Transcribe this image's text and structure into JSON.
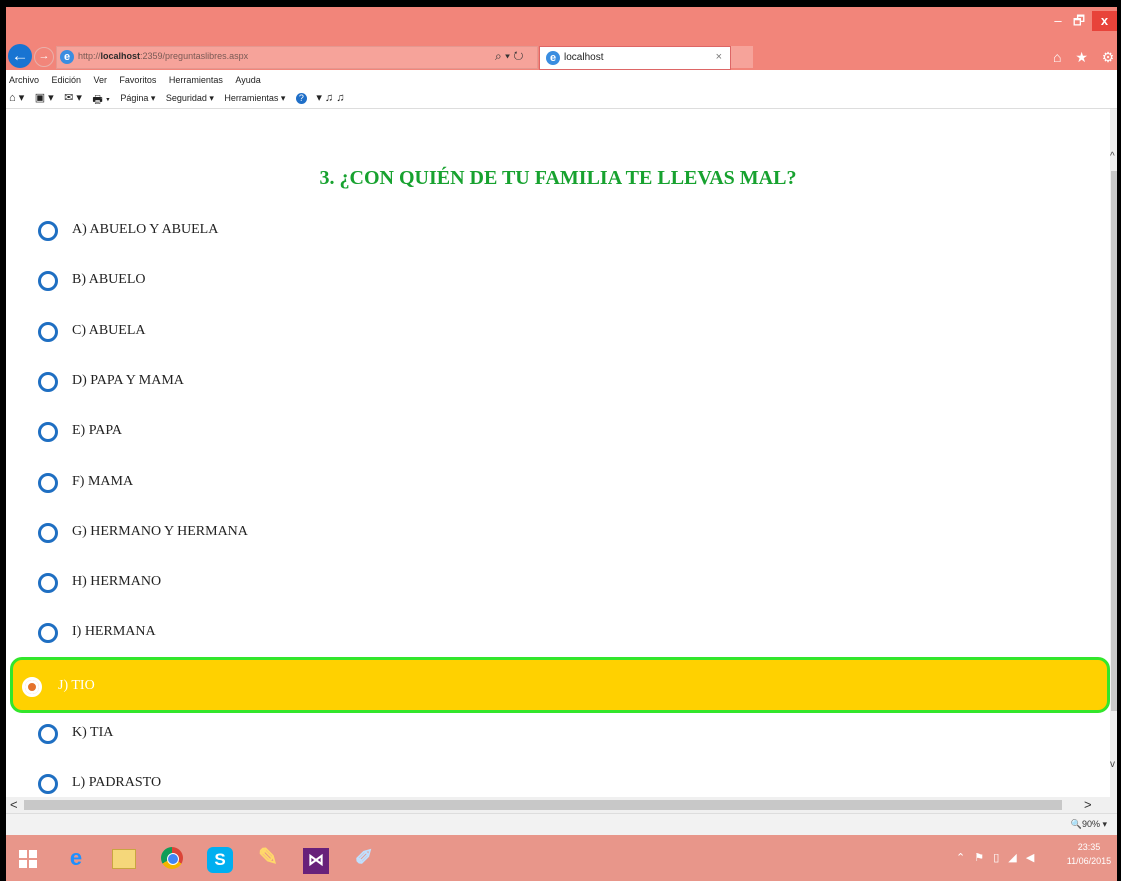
{
  "window": {
    "controls": {
      "minimize": "–",
      "maximize": "🗗",
      "close": "x"
    }
  },
  "navigation": {
    "back_glyph": "←",
    "forward_glyph": "→",
    "address_prefix": "http://",
    "address_host": "localhost",
    "address_path": ":2359/preguntaslibres.aspx",
    "search_controls": "⌕ ▾ ↻",
    "tab_label": "localhost",
    "tab_close": "×",
    "toolbar_icons": "⌂ ★ ⚙"
  },
  "menu": {
    "items": [
      "Archivo",
      "Edición",
      "Ver",
      "Favoritos",
      "Herramientas",
      "Ayuda"
    ]
  },
  "command_bar": {
    "home_glyph": "⌂ ▾",
    "feeds_glyph": "▣ ▾",
    "mail_glyph": "✉ ▾",
    "print_glyph": "🖶 ▾",
    "page_label": "Página ▾",
    "security_label": "Seguridad ▾",
    "tools_label": "Herramientas ▾",
    "help_glyph": "?",
    "extra_icons": "▾ ♫ ♫"
  },
  "question": {
    "title": "3. ¿CON QUIÉN DE TU FAMILIA TE LLEVAS MAL?",
    "options": [
      {
        "label": "A) ABUELO Y ABUELA",
        "selected": false
      },
      {
        "label": "B) ABUELO",
        "selected": false
      },
      {
        "label": "C) ABUELA",
        "selected": false
      },
      {
        "label": "D) PAPA Y MAMA",
        "selected": false
      },
      {
        "label": "E) PAPA",
        "selected": false
      },
      {
        "label": "F) MAMA",
        "selected": false
      },
      {
        "label": "G) HERMANO Y HERMANA",
        "selected": false
      },
      {
        "label": "H) HERMANO",
        "selected": false
      },
      {
        "label": "I) HERMANA",
        "selected": false
      },
      {
        "label": "J) TIO",
        "selected": true
      },
      {
        "label": "K) TIA",
        "selected": false
      },
      {
        "label": "L) PADRASTO",
        "selected": false
      }
    ]
  },
  "scrollbars": {
    "up": "^",
    "down": "v",
    "left": "<",
    "right": ">"
  },
  "status": {
    "zoom": "🔍90%  ▾"
  },
  "taskbar": {
    "apps": [
      "Internet Explorer",
      "Explorador de archivos",
      "Chrome",
      "Skype",
      "Aplicación",
      "Visual Studio",
      "Aplicación"
    ],
    "tray_icons": "⌃ ⚑ ▯ ◢ ◀",
    "time": "23:35",
    "date": "11/06/2015"
  },
  "colors": {
    "title_green": "#17a22f",
    "selected_fill": "#ffd100",
    "selected_border": "#33e62b",
    "radio_blue": "#1f6fc2",
    "chrome_salmon": "#f2857a"
  }
}
